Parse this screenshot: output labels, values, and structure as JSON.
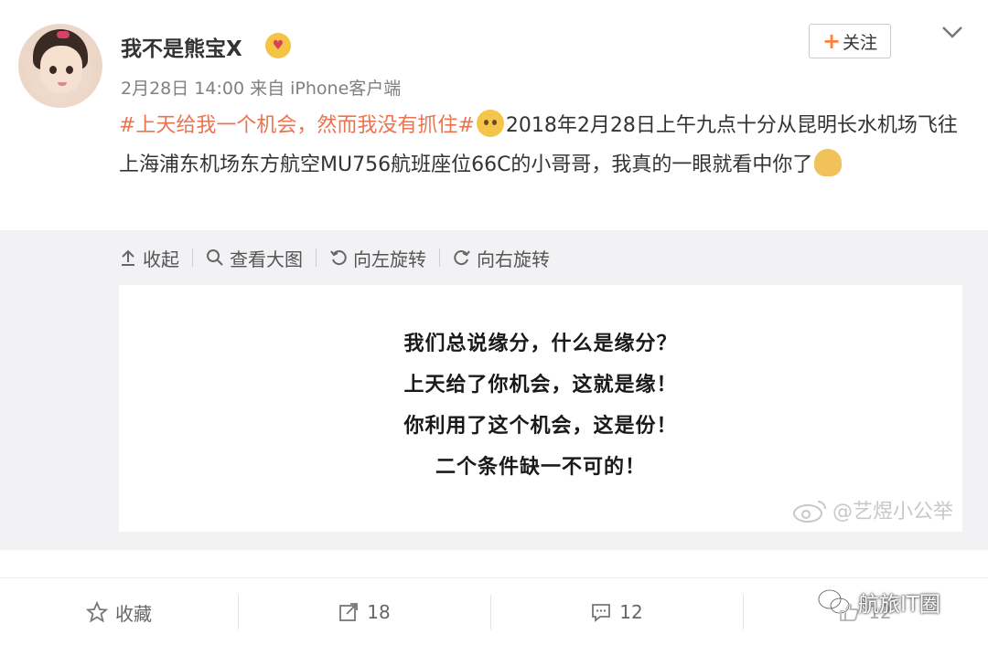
{
  "post": {
    "username": "我不是熊宝X",
    "meta": "2月28日 14:00 来自 iPhone客户端",
    "follow_label": "关注",
    "hashtag": "#上天给我一个机会，然而我没有抓住#",
    "text_part1": "2018年2月28日上午九点十分从昆明长水机场飞往上海浦东机场东方航空MU756航班座位66C的小哥哥，我真的一眼就看中你了"
  },
  "media_toolbar": {
    "collapse": "收起",
    "view_large": "查看大图",
    "rotate_left": "向左旋转",
    "rotate_right": "向右旋转"
  },
  "image": {
    "lines": [
      "我们总说缘分，什么是缘分？",
      "上天给了你机会，这就是缘！",
      "你利用了这个机会，这是份！",
      "二个条件缺一不可的！"
    ],
    "watermark": "@艺煜小公举"
  },
  "footer": {
    "favorite": "收藏",
    "repost": "18",
    "comment": "12",
    "like": "12"
  },
  "brand": {
    "label": "航旅IT圈"
  },
  "colors": {
    "hashtag": "#eb7350",
    "follow_plus": "#ff8140",
    "media_bg": "#f2f2f5"
  }
}
